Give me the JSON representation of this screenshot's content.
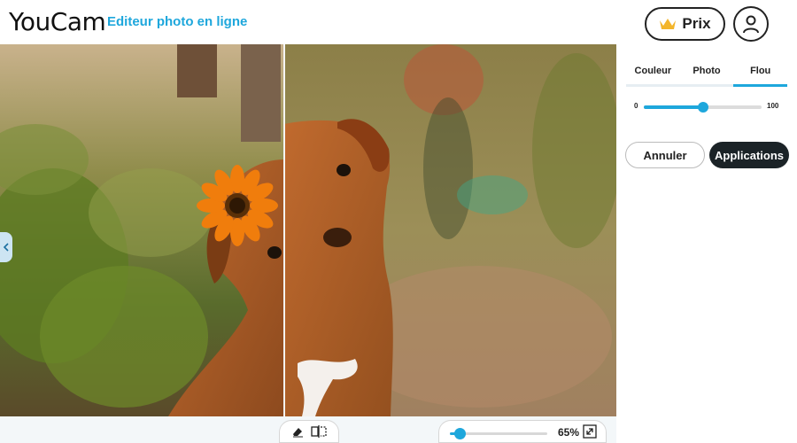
{
  "header": {
    "logo": "YouCam",
    "subtitle": "Editeur photo en ligne",
    "price_label": "Prix",
    "crown_icon": "crown-icon",
    "profile_icon": "user-icon"
  },
  "editor": {
    "image_description_icon": "photo-compare",
    "collapse_icon": "chevron-left-icon"
  },
  "toolbar": {
    "eraser_icon": "eraser-icon",
    "compare_icon": "split-compare-icon",
    "zoom_value": "65%",
    "zoom_fraction": 0.65,
    "fit_icon": "expand-icon"
  },
  "panel": {
    "tabs": [
      {
        "label": "Couleur",
        "active": false
      },
      {
        "label": "Photo",
        "active": false
      },
      {
        "label": "Flou",
        "active": true
      }
    ],
    "slider": {
      "min_label": "0",
      "max_label": "100",
      "value": 50
    },
    "cancel_label": "Annuler",
    "apply_label": "Applications"
  },
  "colors": {
    "accent": "#1ea7dc",
    "dark_button": "#1b2327",
    "crown": "#f3b52b"
  }
}
